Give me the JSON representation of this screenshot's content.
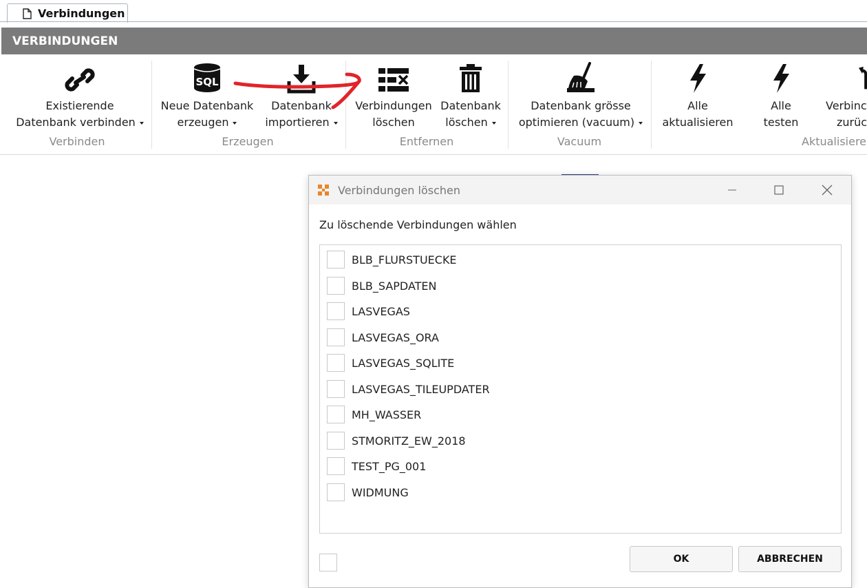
{
  "tab": {
    "label": "Verbindungen",
    "icon": "document-icon"
  },
  "header": {
    "title": "VERBINDUNGEN",
    "bg": "#7b7b7b"
  },
  "ribbon": {
    "groups": [
      {
        "label": "Verbinden"
      },
      {
        "label": "Erzeugen"
      },
      {
        "label": "Entfernen"
      },
      {
        "label": "Vacuum"
      },
      {
        "label": "Aktualisiere"
      }
    ],
    "buttons": [
      {
        "line1": "Existierende",
        "line2": "Datenbank verbinden",
        "dropdown": true,
        "icon": "link-icon"
      },
      {
        "line1": "Neue Datenbank",
        "line2": "erzeugen",
        "dropdown": true,
        "icon": "database-sql-icon",
        "icon_text": "SQL"
      },
      {
        "line1": "Datenbank",
        "line2": "importieren",
        "dropdown": true,
        "icon": "import-download-icon"
      },
      {
        "line1": "Verbindungen",
        "line2": "löschen",
        "dropdown": false,
        "icon": "delete-list-icon"
      },
      {
        "line1": "Datenbank",
        "line2": "löschen",
        "dropdown": true,
        "icon": "trash-icon"
      },
      {
        "line1": "Datenbank grösse",
        "line2": "optimieren (vacuum)",
        "dropdown": true,
        "icon": "broom-icon"
      },
      {
        "line1": "Alle",
        "line2": "aktualisieren",
        "dropdown": false,
        "icon": "lightning-icon"
      },
      {
        "line1": "Alle",
        "line2": "testen",
        "dropdown": false,
        "icon": "lightning-icon"
      },
      {
        "line1": "Verbinc",
        "line2": "zurüc",
        "dropdown": false,
        "icon": "undo-icon"
      }
    ]
  },
  "annotation": {
    "color": "#e0242b",
    "shape": "red-strike-arrow"
  },
  "dialog": {
    "title": "Verbindungen löschen",
    "prompt": "Zu löschende Verbindungen wählen",
    "items": [
      {
        "label": "BLB_FLURSTUECKE",
        "checked": false
      },
      {
        "label": "BLB_SAPDATEN",
        "checked": false
      },
      {
        "label": "LASVEGAS",
        "checked": false
      },
      {
        "label": "LASVEGAS_ORA",
        "checked": false
      },
      {
        "label": "LASVEGAS_SQLITE",
        "checked": false
      },
      {
        "label": "LASVEGAS_TILEUPDATER",
        "checked": false
      },
      {
        "label": "MH_WASSER",
        "checked": false
      },
      {
        "label": "STMORITZ_EW_2018",
        "checked": false
      },
      {
        "label": "TEST_PG_001",
        "checked": false
      },
      {
        "label": "WIDMUNG",
        "checked": false
      }
    ],
    "ok_label": "OK",
    "cancel_label": "ABBRECHEN",
    "accent": "#e8872a"
  }
}
